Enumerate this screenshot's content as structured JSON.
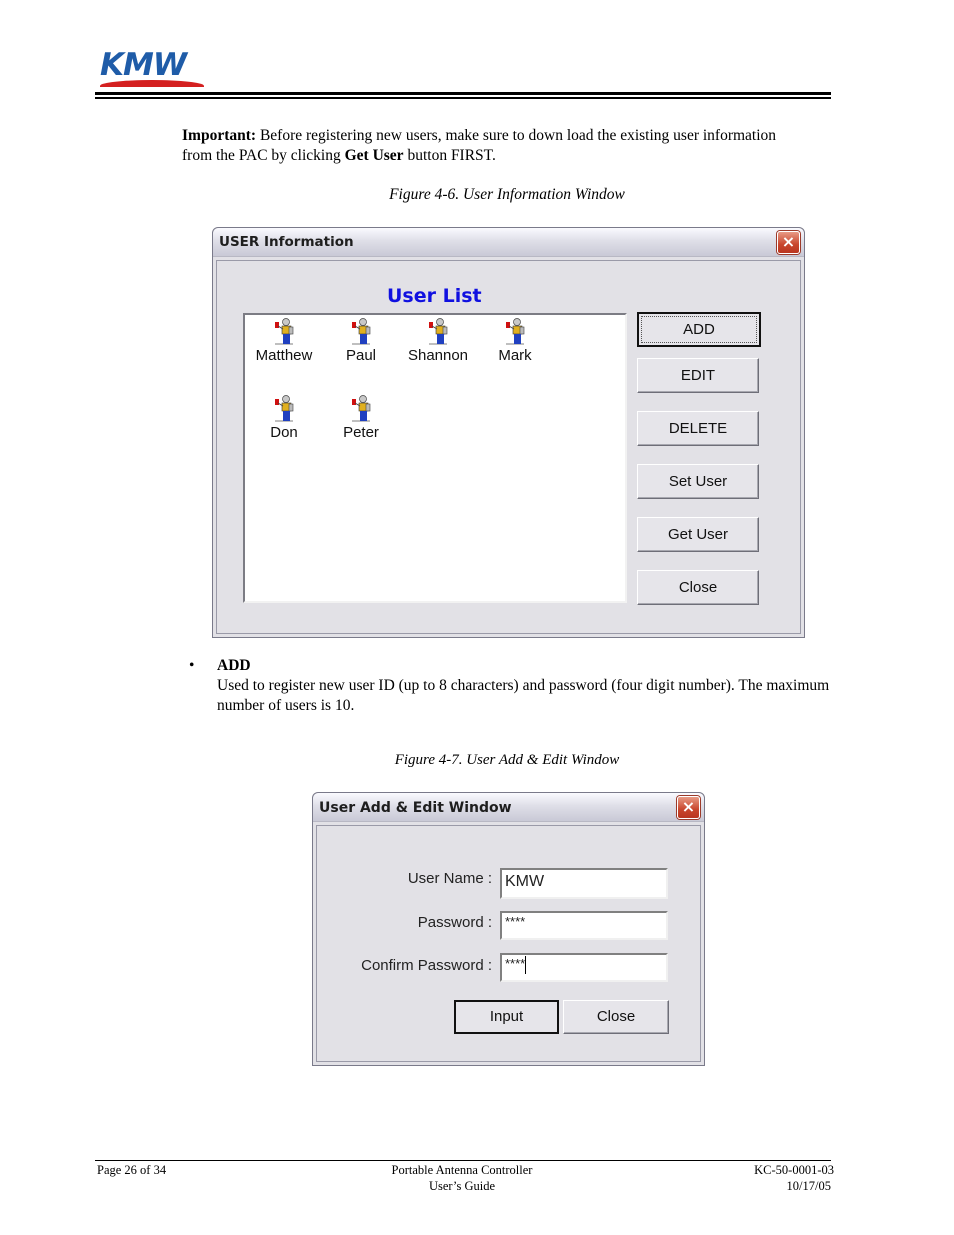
{
  "header": {
    "logo_text": "KMW"
  },
  "intro": {
    "important_label": "Important:",
    "text_1": " Before registering new users, make sure to down load the existing user information from the PAC by clicking ",
    "get_user_bold": "Get User",
    "text_2": " button FIRST."
  },
  "figure1": {
    "caption": "Figure 4-6. User Information Window",
    "window": {
      "title": "USER Information",
      "close_icon": "×",
      "list_title": "User List",
      "users": [
        {
          "name": "Matthew",
          "icon": "user-figure-icon"
        },
        {
          "name": "Paul",
          "icon": "user-figure-icon"
        },
        {
          "name": "Shannon",
          "icon": "user-figure-icon"
        },
        {
          "name": "Mark",
          "icon": "user-figure-icon"
        },
        {
          "name": "Don",
          "icon": "user-figure-icon"
        },
        {
          "name": "Peter",
          "icon": "user-figure-icon"
        }
      ],
      "buttons": {
        "add": "ADD",
        "edit": "EDIT",
        "delete": "DELETE",
        "set_user": "Set User",
        "get_user": "Get User",
        "close": "Close"
      }
    }
  },
  "add_section": {
    "bullet": "•",
    "heading": "ADD",
    "description": "Used to register new user ID (up to 8 characters) and password (four digit number). The maximum number of users is 10."
  },
  "figure2": {
    "caption": "Figure 4-7. User Add & Edit Window",
    "window": {
      "title": "User Add & Edit Window",
      "close_icon": "×",
      "fields": {
        "user_name_label": "User Name :",
        "user_name_value": "KMW",
        "password_label": "Password :",
        "password_value": "****",
        "confirm_label": "Confirm Password :",
        "confirm_value": "****"
      },
      "buttons": {
        "input": "Input",
        "close": "Close"
      }
    }
  },
  "footer": {
    "page": "Page 26 of 34",
    "title_line1": "Portable Antenna Controller",
    "title_line2": "User’s Guide",
    "doc_number": "KC-50-0001-03",
    "date": "10/17/05"
  }
}
